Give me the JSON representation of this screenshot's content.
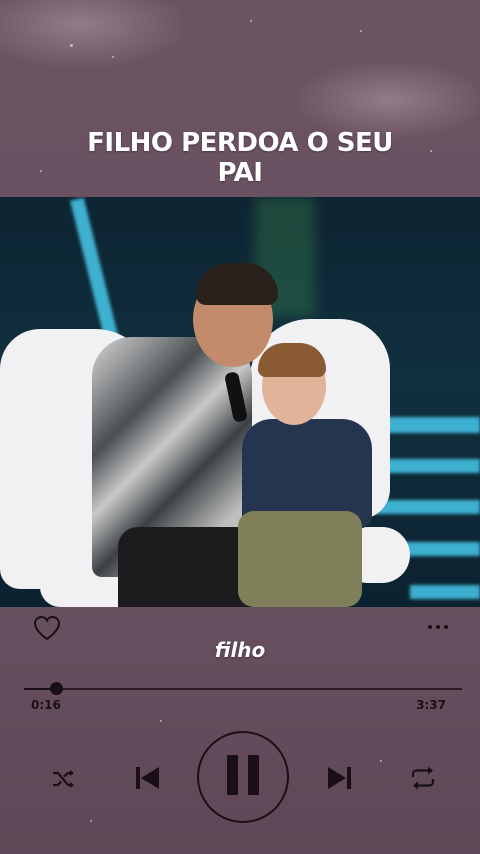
{
  "song": {
    "title_line1": "FILHO PERDOA O SEU",
    "title_line2": "PAI",
    "current_lyric": "filho"
  },
  "player": {
    "elapsed": "0:16",
    "duration": "3:37",
    "progress_fraction": 0.074,
    "state": "playing"
  },
  "icons": {
    "like": "heart-outline-icon",
    "menu": "more-dots-icon",
    "shuffle": "shuffle-icon",
    "previous": "previous-icon",
    "pause": "pause-icon",
    "next": "next-icon",
    "repeat": "repeat-icon"
  },
  "colors": {
    "background": "#6a5261",
    "controls": "#1b0f17",
    "text": "#ffffff",
    "stage_light": "#46c8eb"
  }
}
